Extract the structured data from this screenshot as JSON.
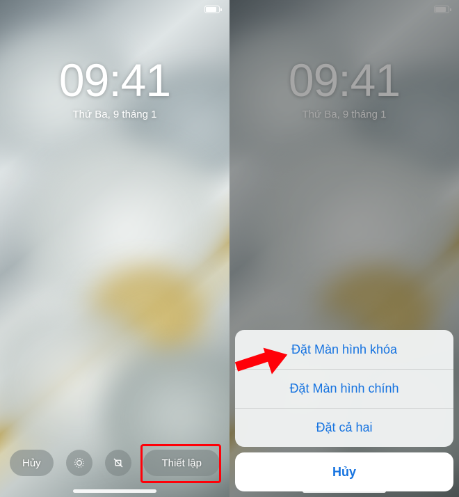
{
  "left": {
    "time": "09:41",
    "date": "Thứ Ba, 9 tháng 1",
    "cancel_label": "Hủy",
    "set_label": "Thiết lập"
  },
  "right": {
    "time": "09:41",
    "date": "Thứ Ba, 9 tháng 1",
    "sheet": {
      "set_lock": "Đặt Màn hình khóa",
      "set_home": "Đặt Màn hình chính",
      "set_both": "Đặt cả hai",
      "cancel": "Hủy"
    }
  }
}
